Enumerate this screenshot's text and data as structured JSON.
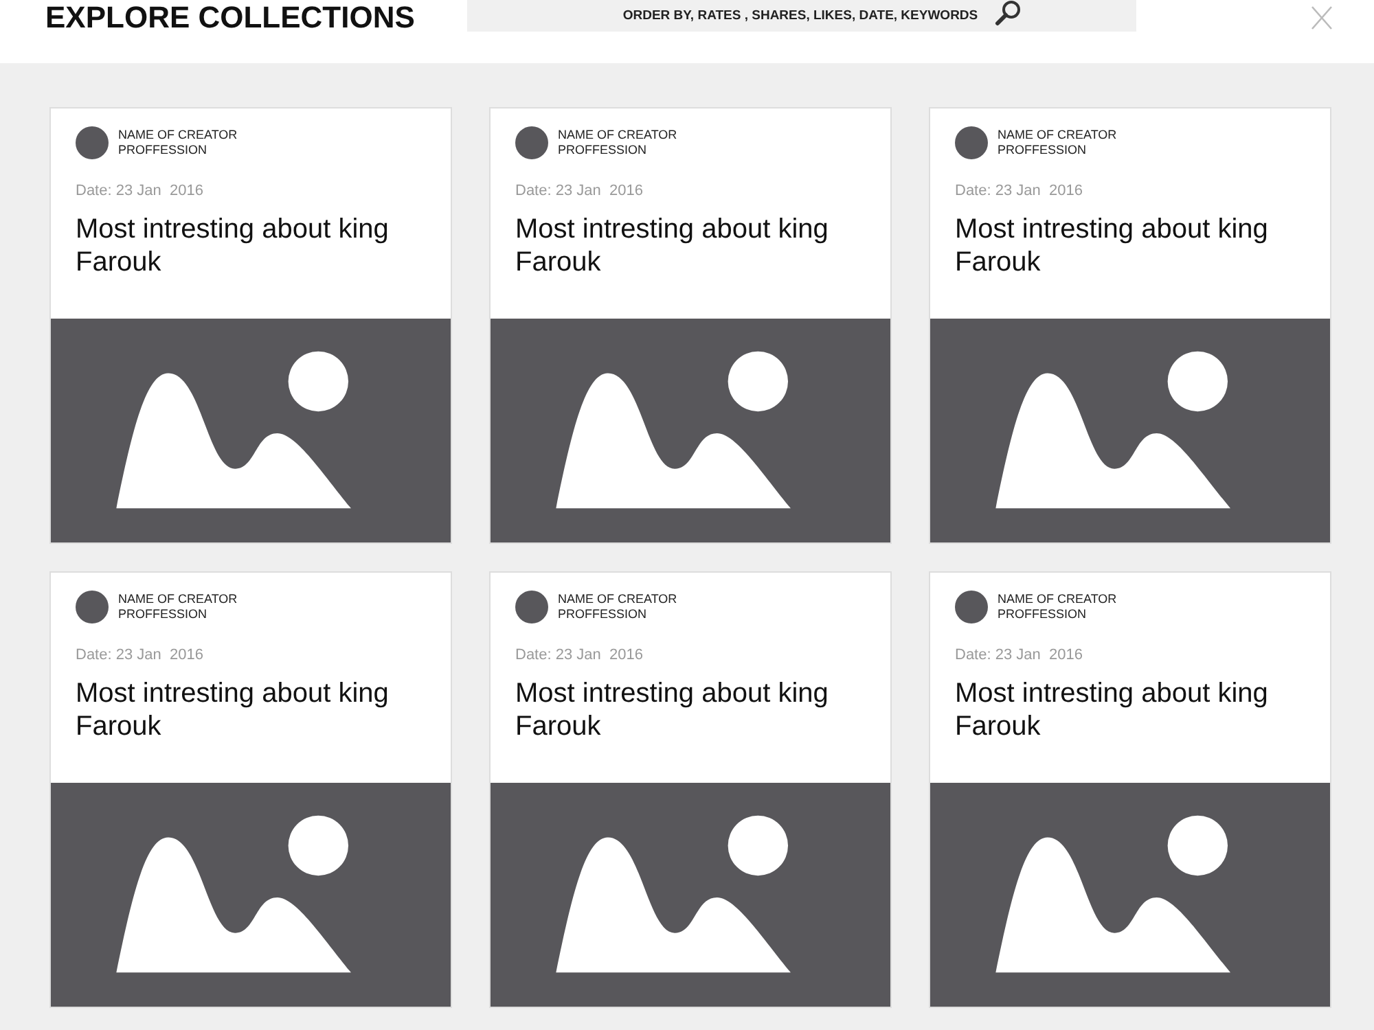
{
  "header": {
    "title": "EXPLORE COLLECTIONS",
    "search": {
      "value": "ORDER BY, RATES , SHARES, LIKES, DATE, KEYWORDS"
    }
  },
  "cards": [
    {
      "creator": "NAME OF CREATOR",
      "profession": "PROFFESSION",
      "date": "Date: 23 Jan  2016",
      "title": "Most intresting about king Farouk"
    },
    {
      "creator": "NAME OF CREATOR",
      "profession": "PROFFESSION",
      "date": "Date: 23 Jan  2016",
      "title": "Most intresting about king Farouk"
    },
    {
      "creator": "NAME OF CREATOR",
      "profession": "PROFFESSION",
      "date": "Date: 23 Jan  2016",
      "title": "Most intresting about king Farouk"
    },
    {
      "creator": "NAME OF CREATOR",
      "profession": "PROFFESSION",
      "date": "Date: 23 Jan  2016",
      "title": "Most intresting about king Farouk"
    },
    {
      "creator": "NAME OF CREATOR",
      "profession": "PROFFESSION",
      "date": "Date: 23 Jan  2016",
      "title": "Most intresting about king Farouk"
    },
    {
      "creator": "NAME OF CREATOR",
      "profession": "PROFFESSION",
      "date": "Date: 23 Jan  2016",
      "title": "Most intresting about king Farouk"
    }
  ]
}
